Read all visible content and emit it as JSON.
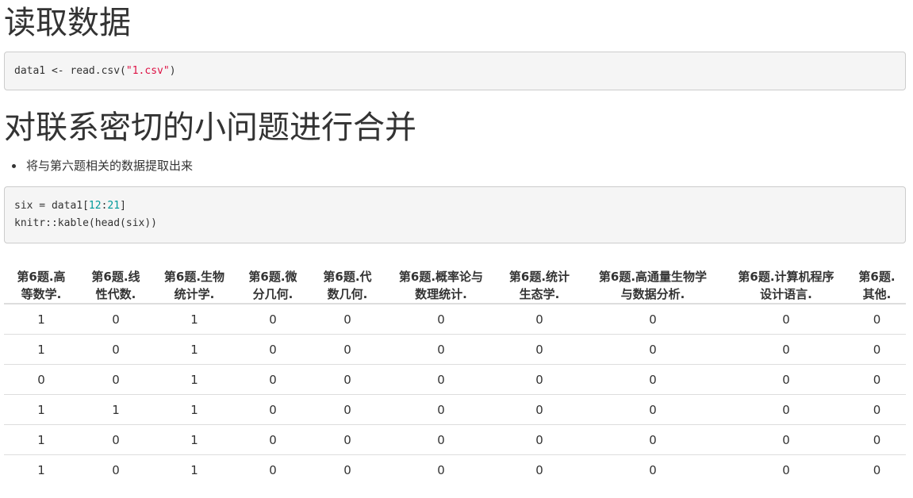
{
  "headings": {
    "read_data": "读取数据",
    "merge": "对联系密切的小问题进行合并"
  },
  "code1": {
    "part1": "data1 <- read.csv(",
    "string": "\"1.csv\"",
    "part2": ")"
  },
  "bullets": [
    "将与第六题相关的数据提取出来"
  ],
  "code2": {
    "line1_a": "six = data1[",
    "line1_n1": "12",
    "line1_colon": ":",
    "line1_n2": "21",
    "line1_b": "]",
    "line2": "knitr::kable(head(six))"
  },
  "table": {
    "headers": [
      [
        "第6题.高",
        "等数学."
      ],
      [
        "第6题.线",
        "性代数."
      ],
      [
        "第6题.生物",
        "统计学."
      ],
      [
        "第6题.微",
        "分几何."
      ],
      [
        "第6题.代",
        "数几何."
      ],
      [
        "第6题.概率论与",
        "数理统计."
      ],
      [
        "第6题.统计",
        "生态学."
      ],
      [
        "第6题.高通量生物学",
        "与数据分析."
      ],
      [
        "第6题.计算机程序",
        "设计语言."
      ],
      [
        "第6题.",
        "其他."
      ]
    ],
    "rows": [
      [
        "1",
        "0",
        "1",
        "0",
        "0",
        "0",
        "0",
        "0",
        "0",
        "0"
      ],
      [
        "1",
        "0",
        "1",
        "0",
        "0",
        "0",
        "0",
        "0",
        "0",
        "0"
      ],
      [
        "0",
        "0",
        "1",
        "0",
        "0",
        "0",
        "0",
        "0",
        "0",
        "0"
      ],
      [
        "1",
        "1",
        "1",
        "0",
        "0",
        "0",
        "0",
        "0",
        "0",
        "0"
      ],
      [
        "1",
        "0",
        "1",
        "0",
        "0",
        "0",
        "0",
        "0",
        "0",
        "0"
      ],
      [
        "1",
        "0",
        "1",
        "0",
        "0",
        "0",
        "0",
        "0",
        "0",
        "0"
      ]
    ]
  }
}
